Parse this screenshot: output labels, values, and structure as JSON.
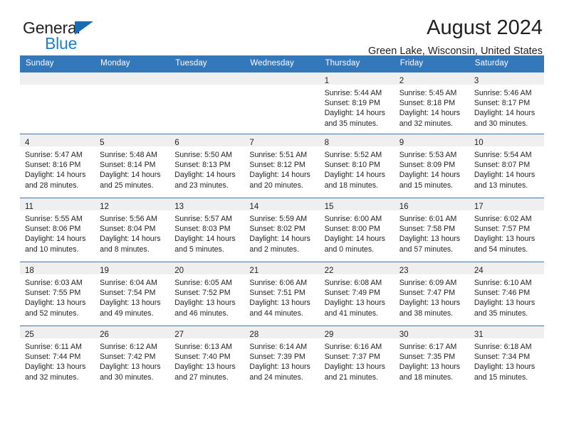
{
  "brand": {
    "name_part1": "General",
    "name_part2": "Blue",
    "triangle_color": "#1a6bb5",
    "blue_color": "#1b7fd4"
  },
  "header": {
    "title": "August 2024",
    "subtitle": "Green Lake, Wisconsin, United States"
  },
  "theme": {
    "header_row_bg": "#3478bc",
    "daynum_band_bg": "#efefef",
    "row_divider": "#3478bc",
    "text": "#231f20"
  },
  "weekday_headers": [
    "Sunday",
    "Monday",
    "Tuesday",
    "Wednesday",
    "Thursday",
    "Friday",
    "Saturday"
  ],
  "weeks": [
    [
      {
        "day": "",
        "empty": true
      },
      {
        "day": "",
        "empty": true
      },
      {
        "day": "",
        "empty": true
      },
      {
        "day": "",
        "empty": true
      },
      {
        "day": "1",
        "sunrise": "Sunrise: 5:44 AM",
        "sunset": "Sunset: 8:19 PM",
        "daylight_line1": "Daylight: 14 hours",
        "daylight_line2": "and 35 minutes."
      },
      {
        "day": "2",
        "sunrise": "Sunrise: 5:45 AM",
        "sunset": "Sunset: 8:18 PM",
        "daylight_line1": "Daylight: 14 hours",
        "daylight_line2": "and 32 minutes."
      },
      {
        "day": "3",
        "sunrise": "Sunrise: 5:46 AM",
        "sunset": "Sunset: 8:17 PM",
        "daylight_line1": "Daylight: 14 hours",
        "daylight_line2": "and 30 minutes."
      }
    ],
    [
      {
        "day": "4",
        "sunrise": "Sunrise: 5:47 AM",
        "sunset": "Sunset: 8:16 PM",
        "daylight_line1": "Daylight: 14 hours",
        "daylight_line2": "and 28 minutes."
      },
      {
        "day": "5",
        "sunrise": "Sunrise: 5:48 AM",
        "sunset": "Sunset: 8:14 PM",
        "daylight_line1": "Daylight: 14 hours",
        "daylight_line2": "and 25 minutes."
      },
      {
        "day": "6",
        "sunrise": "Sunrise: 5:50 AM",
        "sunset": "Sunset: 8:13 PM",
        "daylight_line1": "Daylight: 14 hours",
        "daylight_line2": "and 23 minutes."
      },
      {
        "day": "7",
        "sunrise": "Sunrise: 5:51 AM",
        "sunset": "Sunset: 8:12 PM",
        "daylight_line1": "Daylight: 14 hours",
        "daylight_line2": "and 20 minutes."
      },
      {
        "day": "8",
        "sunrise": "Sunrise: 5:52 AM",
        "sunset": "Sunset: 8:10 PM",
        "daylight_line1": "Daylight: 14 hours",
        "daylight_line2": "and 18 minutes."
      },
      {
        "day": "9",
        "sunrise": "Sunrise: 5:53 AM",
        "sunset": "Sunset: 8:09 PM",
        "daylight_line1": "Daylight: 14 hours",
        "daylight_line2": "and 15 minutes."
      },
      {
        "day": "10",
        "sunrise": "Sunrise: 5:54 AM",
        "sunset": "Sunset: 8:07 PM",
        "daylight_line1": "Daylight: 14 hours",
        "daylight_line2": "and 13 minutes."
      }
    ],
    [
      {
        "day": "11",
        "sunrise": "Sunrise: 5:55 AM",
        "sunset": "Sunset: 8:06 PM",
        "daylight_line1": "Daylight: 14 hours",
        "daylight_line2": "and 10 minutes."
      },
      {
        "day": "12",
        "sunrise": "Sunrise: 5:56 AM",
        "sunset": "Sunset: 8:04 PM",
        "daylight_line1": "Daylight: 14 hours",
        "daylight_line2": "and 8 minutes."
      },
      {
        "day": "13",
        "sunrise": "Sunrise: 5:57 AM",
        "sunset": "Sunset: 8:03 PM",
        "daylight_line1": "Daylight: 14 hours",
        "daylight_line2": "and 5 minutes."
      },
      {
        "day": "14",
        "sunrise": "Sunrise: 5:59 AM",
        "sunset": "Sunset: 8:02 PM",
        "daylight_line1": "Daylight: 14 hours",
        "daylight_line2": "and 2 minutes."
      },
      {
        "day": "15",
        "sunrise": "Sunrise: 6:00 AM",
        "sunset": "Sunset: 8:00 PM",
        "daylight_line1": "Daylight: 14 hours",
        "daylight_line2": "and 0 minutes."
      },
      {
        "day": "16",
        "sunrise": "Sunrise: 6:01 AM",
        "sunset": "Sunset: 7:58 PM",
        "daylight_line1": "Daylight: 13 hours",
        "daylight_line2": "and 57 minutes."
      },
      {
        "day": "17",
        "sunrise": "Sunrise: 6:02 AM",
        "sunset": "Sunset: 7:57 PM",
        "daylight_line1": "Daylight: 13 hours",
        "daylight_line2": "and 54 minutes."
      }
    ],
    [
      {
        "day": "18",
        "sunrise": "Sunrise: 6:03 AM",
        "sunset": "Sunset: 7:55 PM",
        "daylight_line1": "Daylight: 13 hours",
        "daylight_line2": "and 52 minutes."
      },
      {
        "day": "19",
        "sunrise": "Sunrise: 6:04 AM",
        "sunset": "Sunset: 7:54 PM",
        "daylight_line1": "Daylight: 13 hours",
        "daylight_line2": "and 49 minutes."
      },
      {
        "day": "20",
        "sunrise": "Sunrise: 6:05 AM",
        "sunset": "Sunset: 7:52 PM",
        "daylight_line1": "Daylight: 13 hours",
        "daylight_line2": "and 46 minutes."
      },
      {
        "day": "21",
        "sunrise": "Sunrise: 6:06 AM",
        "sunset": "Sunset: 7:51 PM",
        "daylight_line1": "Daylight: 13 hours",
        "daylight_line2": "and 44 minutes."
      },
      {
        "day": "22",
        "sunrise": "Sunrise: 6:08 AM",
        "sunset": "Sunset: 7:49 PM",
        "daylight_line1": "Daylight: 13 hours",
        "daylight_line2": "and 41 minutes."
      },
      {
        "day": "23",
        "sunrise": "Sunrise: 6:09 AM",
        "sunset": "Sunset: 7:47 PM",
        "daylight_line1": "Daylight: 13 hours",
        "daylight_line2": "and 38 minutes."
      },
      {
        "day": "24",
        "sunrise": "Sunrise: 6:10 AM",
        "sunset": "Sunset: 7:46 PM",
        "daylight_line1": "Daylight: 13 hours",
        "daylight_line2": "and 35 minutes."
      }
    ],
    [
      {
        "day": "25",
        "sunrise": "Sunrise: 6:11 AM",
        "sunset": "Sunset: 7:44 PM",
        "daylight_line1": "Daylight: 13 hours",
        "daylight_line2": "and 32 minutes."
      },
      {
        "day": "26",
        "sunrise": "Sunrise: 6:12 AM",
        "sunset": "Sunset: 7:42 PM",
        "daylight_line1": "Daylight: 13 hours",
        "daylight_line2": "and 30 minutes."
      },
      {
        "day": "27",
        "sunrise": "Sunrise: 6:13 AM",
        "sunset": "Sunset: 7:40 PM",
        "daylight_line1": "Daylight: 13 hours",
        "daylight_line2": "and 27 minutes."
      },
      {
        "day": "28",
        "sunrise": "Sunrise: 6:14 AM",
        "sunset": "Sunset: 7:39 PM",
        "daylight_line1": "Daylight: 13 hours",
        "daylight_line2": "and 24 minutes."
      },
      {
        "day": "29",
        "sunrise": "Sunrise: 6:16 AM",
        "sunset": "Sunset: 7:37 PM",
        "daylight_line1": "Daylight: 13 hours",
        "daylight_line2": "and 21 minutes."
      },
      {
        "day": "30",
        "sunrise": "Sunrise: 6:17 AM",
        "sunset": "Sunset: 7:35 PM",
        "daylight_line1": "Daylight: 13 hours",
        "daylight_line2": "and 18 minutes."
      },
      {
        "day": "31",
        "sunrise": "Sunrise: 6:18 AM",
        "sunset": "Sunset: 7:34 PM",
        "daylight_line1": "Daylight: 13 hours",
        "daylight_line2": "and 15 minutes."
      }
    ]
  ]
}
